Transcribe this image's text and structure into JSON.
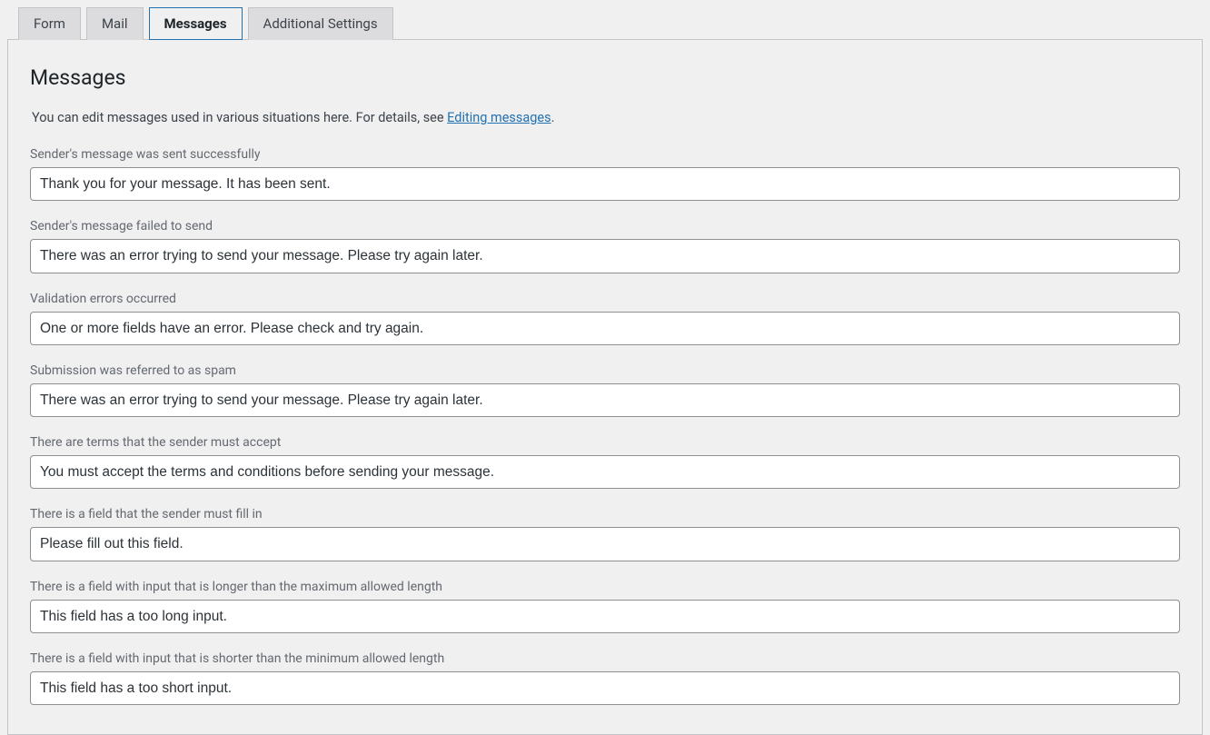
{
  "tabs": {
    "form": "Form",
    "mail": "Mail",
    "messages": "Messages",
    "additional": "Additional Settings"
  },
  "heading": "Messages",
  "intro_prefix": "You can edit messages used in various situations here. For details, see ",
  "intro_link": "Editing messages",
  "intro_suffix": ".",
  "fields": {
    "sent_ok": {
      "label": "Sender's message was sent successfully",
      "value": "Thank you for your message. It has been sent."
    },
    "sent_ng": {
      "label": "Sender's message failed to send",
      "value": "There was an error trying to send your message. Please try again later."
    },
    "validation_error": {
      "label": "Validation errors occurred",
      "value": "One or more fields have an error. Please check and try again."
    },
    "spam": {
      "label": "Submission was referred to as spam",
      "value": "There was an error trying to send your message. Please try again later."
    },
    "accept_terms": {
      "label": "There are terms that the sender must accept",
      "value": "You must accept the terms and conditions before sending your message."
    },
    "required": {
      "label": "There is a field that the sender must fill in",
      "value": "Please fill out this field."
    },
    "too_long": {
      "label": "There is a field with input that is longer than the maximum allowed length",
      "value": "This field has a too long input."
    },
    "too_short": {
      "label": "There is a field with input that is shorter than the minimum allowed length",
      "value": "This field has a too short input."
    }
  }
}
